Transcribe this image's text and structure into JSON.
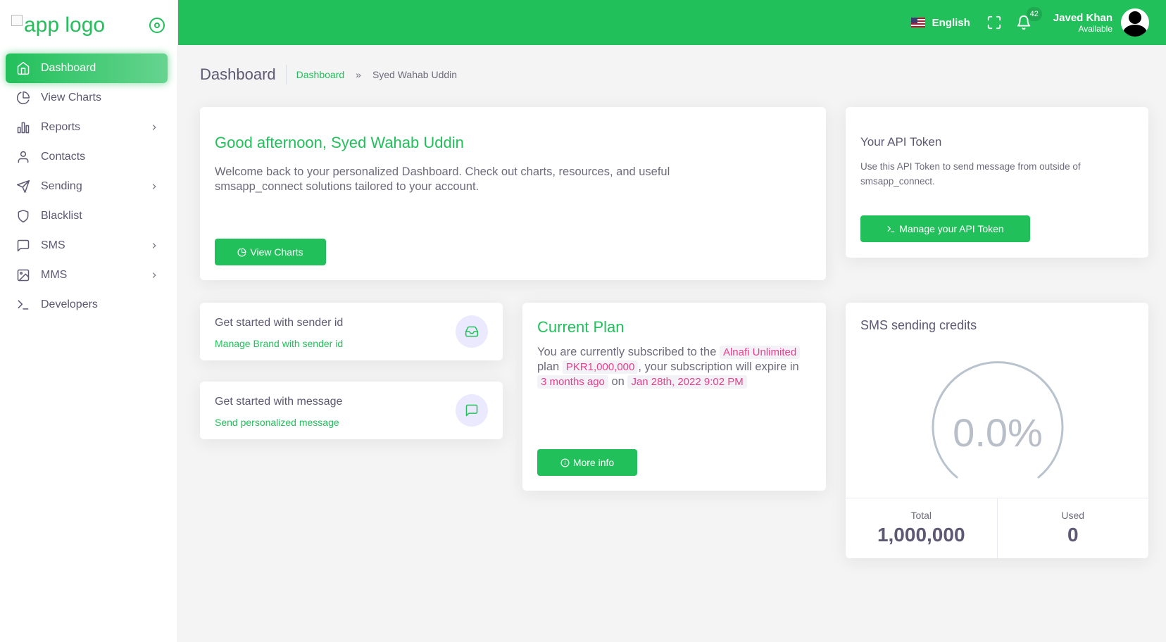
{
  "brand": {
    "logo_alt": "app logo"
  },
  "sidebar": {
    "items": [
      {
        "label": "Dashboard",
        "icon": "home-icon",
        "active": true,
        "has_children": false
      },
      {
        "label": "View Charts",
        "icon": "pie-chart-icon",
        "active": false,
        "has_children": false
      },
      {
        "label": "Reports",
        "icon": "bar-chart-icon",
        "active": false,
        "has_children": true
      },
      {
        "label": "Contacts",
        "icon": "user-icon",
        "active": false,
        "has_children": false
      },
      {
        "label": "Sending",
        "icon": "send-icon",
        "active": false,
        "has_children": true
      },
      {
        "label": "Blacklist",
        "icon": "shield-icon",
        "active": false,
        "has_children": false
      },
      {
        "label": "SMS",
        "icon": "message-square-icon",
        "active": false,
        "has_children": true
      },
      {
        "label": "MMS",
        "icon": "image-icon",
        "active": false,
        "has_children": true
      },
      {
        "label": "Developers",
        "icon": "terminal-icon",
        "active": false,
        "has_children": false
      }
    ]
  },
  "topbar": {
    "language": "English",
    "notification_count": "42",
    "user_name": "Javed Khan",
    "user_status": "Available"
  },
  "header": {
    "title": "Dashboard",
    "breadcrumb_link": "Dashboard",
    "breadcrumb_sep": "»",
    "breadcrumb_current": "Syed Wahab Uddin"
  },
  "welcome": {
    "greeting": "Good afternoon, Syed Wahab Uddin",
    "text": "Welcome back to your personalized Dashboard. Check out charts, resources, and useful smsapp_connect solutions tailored to your account.",
    "button": "View Charts"
  },
  "api_token": {
    "title": "Your API Token",
    "text": "Use this API Token to send message from outside of smsapp_connect.",
    "button": "Manage your API Token"
  },
  "sender_id": {
    "title": "Get started with sender id",
    "link": "Manage Brand with sender id"
  },
  "message": {
    "title": "Get started with message",
    "link": "Send personalized message"
  },
  "plan": {
    "title": "Current Plan",
    "text_1": "You are currently subscribed to the",
    "plan_name": "Alnafi Unlimited",
    "text_2": "plan",
    "price": "PKR1,000,000",
    "text_3": ", your subscription will expire in",
    "relative": "3 months ago",
    "text_4": "on",
    "date": "Jan 28th, 2022 9:02 PM",
    "button": "More info"
  },
  "credits": {
    "title": "SMS sending credits",
    "percent": "0.0%",
    "total_label": "Total",
    "total_value": "1,000,000",
    "used_label": "Used",
    "used_value": "0"
  },
  "colors": {
    "primary": "#22c05b",
    "code_pink": "#e83e8c"
  }
}
